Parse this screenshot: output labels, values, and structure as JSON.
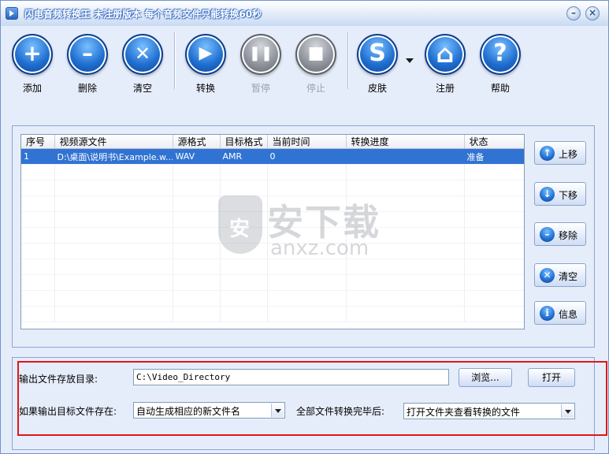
{
  "window": {
    "title": "闪电音频转换王  未注册版本 每个音频文件只能转换60秒",
    "minimize_glyph": "–",
    "close_glyph": "×"
  },
  "toolbar": {
    "items": [
      {
        "label": "添加",
        "icon": "plus-icon",
        "glyph": "+",
        "enabled": true
      },
      {
        "label": "删除",
        "icon": "minus-icon",
        "glyph": "–",
        "enabled": true
      },
      {
        "label": "清空",
        "icon": "clear-x-icon",
        "glyph": "✕",
        "enabled": true
      },
      {
        "label": "转换",
        "icon": "play-icon",
        "glyph": "▶",
        "enabled": true
      },
      {
        "label": "暂停",
        "icon": "pause-icon",
        "glyph": "❚❚",
        "enabled": false
      },
      {
        "label": "停止",
        "icon": "stop-icon",
        "glyph": "■",
        "enabled": false
      },
      {
        "label": "皮肤",
        "icon": "skin-s-icon",
        "glyph": "S",
        "enabled": true
      },
      {
        "label": "注册",
        "icon": "home-icon",
        "glyph": "⌂",
        "enabled": true
      },
      {
        "label": "帮助",
        "icon": "help-icon",
        "glyph": "?",
        "enabled": true
      }
    ]
  },
  "file_list": {
    "columns": [
      "序号",
      "视频源文件",
      "源格式",
      "目标格式",
      "当前时间",
      "转换进度",
      "状态"
    ],
    "rows": [
      {
        "index": "1",
        "source": "D:\\桌面\\说明书\\Example.w...",
        "src_format": "WAV",
        "dst_format": "AMR",
        "current_time": "0",
        "progress": "",
        "status": "准备"
      }
    ]
  },
  "side_buttons": [
    {
      "label": "上移",
      "icon": "arrow-up-icon",
      "glyph": "↑"
    },
    {
      "label": "下移",
      "icon": "arrow-down-icon",
      "glyph": "↓"
    },
    {
      "label": "移除",
      "icon": "remove-minus-icon",
      "glyph": "–"
    },
    {
      "label": "清空",
      "icon": "clear-x-icon",
      "glyph": "✕"
    },
    {
      "label": "信息",
      "icon": "info-icon",
      "glyph": "i"
    }
  ],
  "output": {
    "dir_label": "输出文件存放目录:",
    "dir_value": "C:\\Video_Directory",
    "browse_label": "浏览...",
    "open_label": "打开",
    "exists_label": "如果输出目标文件存在:",
    "exists_value": "自动生成相应的新文件名",
    "after_label": "全部文件转换完毕后:",
    "after_value": "打开文件夹查看转换的文件"
  },
  "watermark": {
    "shield_char": "安",
    "big_text": "安下载",
    "small_text": "anxz.com"
  },
  "colors": {
    "accent": "#1f6fd1",
    "selection": "#3173d2",
    "highlight_border": "#e0161a",
    "window_bg": "#e6edfa"
  }
}
